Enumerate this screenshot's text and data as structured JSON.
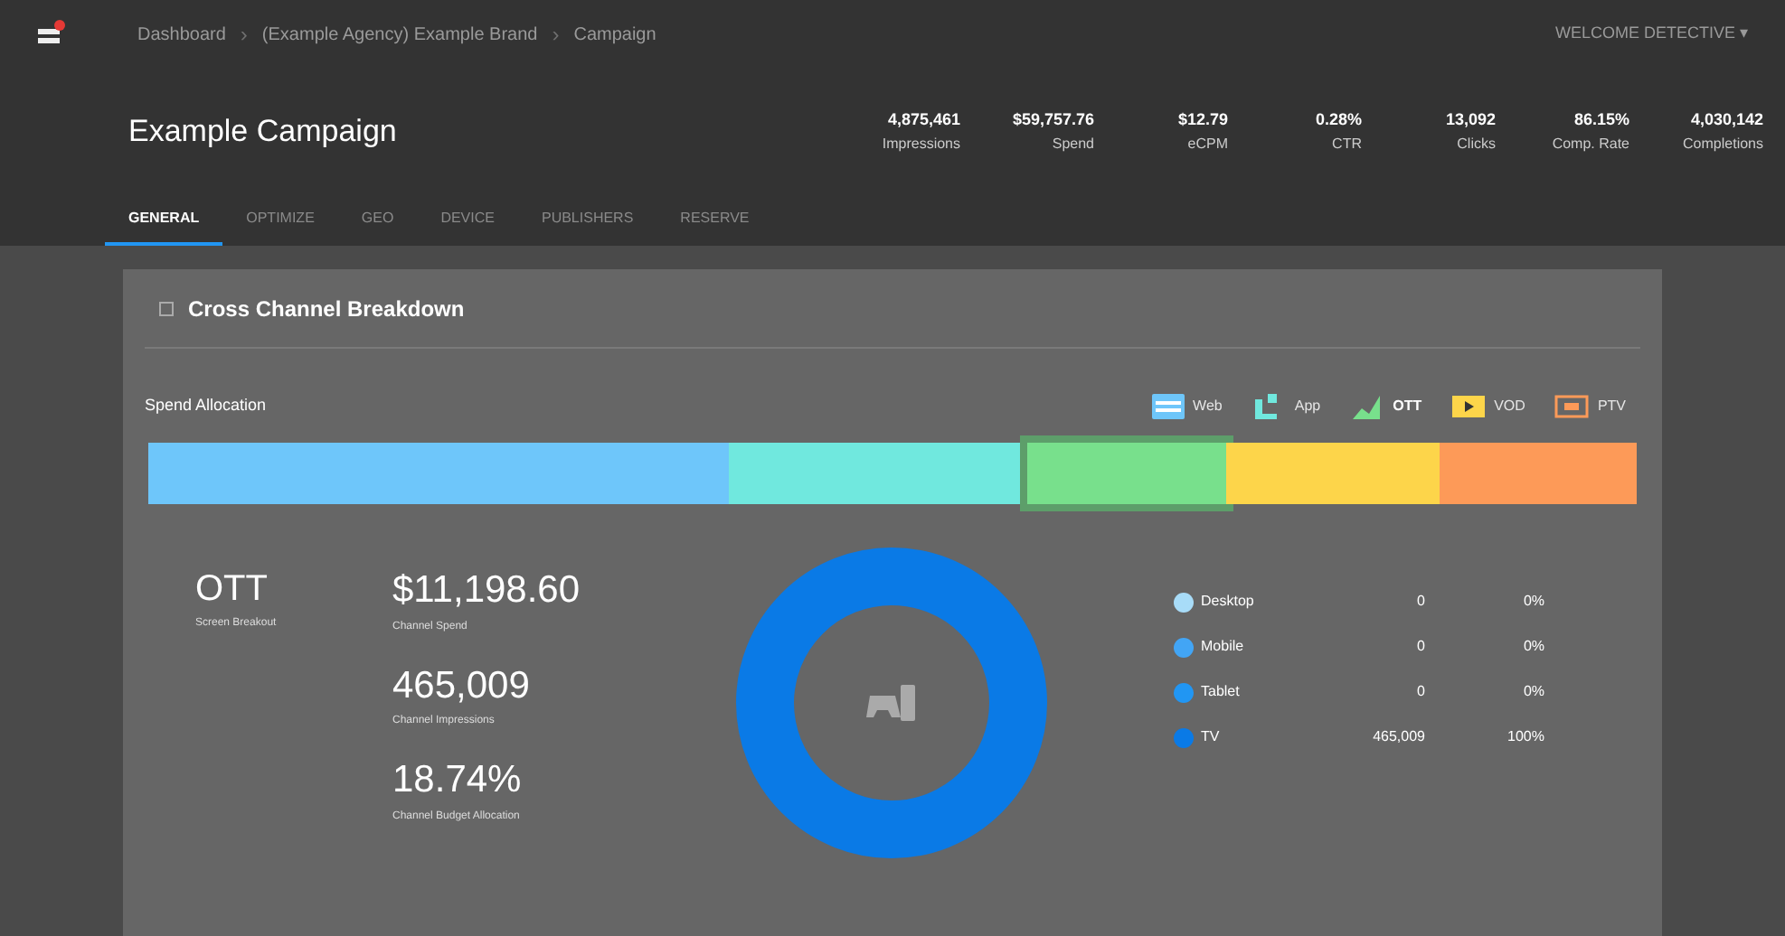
{
  "breadcrumb": [
    {
      "kind": "link",
      "text": "Dashboard"
    },
    {
      "kind": "separator",
      "text": "›"
    },
    {
      "kind": "link",
      "text": "(Example Agency) Example Brand"
    },
    {
      "kind": "separator",
      "text": "›"
    },
    {
      "kind": "link",
      "text": "Campaign"
    }
  ],
  "user_menu": "WELCOME DETECTIVE ▾",
  "title": "Example Campaign",
  "metrics": [
    {
      "value": "4,875,461",
      "label": "Impressions"
    },
    {
      "value": "$59,757.76",
      "label": "Spend"
    },
    {
      "value": "$12.79",
      "label": "eCPM"
    },
    {
      "value": "0.28%",
      "label": "CTR"
    },
    {
      "value": "13,092",
      "label": "Clicks"
    },
    {
      "value": "86.15%",
      "label": "Comp. Rate"
    },
    {
      "value": "4,030,142",
      "label": "Completions"
    }
  ],
  "tabs": [
    {
      "label": "GENERAL",
      "selected": true
    },
    {
      "label": "OPTIMIZE",
      "selected": false
    },
    {
      "label": "GEO",
      "selected": false
    },
    {
      "label": "DEVICE",
      "selected": false
    },
    {
      "label": "PUBLISHERS",
      "selected": false
    },
    {
      "label": "RESERVE",
      "selected": false
    }
  ],
  "card": {
    "title": "Cross Channel Breakdown",
    "allocation_label": "Spend Allocation",
    "channels": [
      {
        "label": "Web",
        "kind": "web",
        "color": "#6ec6fa",
        "selected": false
      },
      {
        "label": "App",
        "kind": "app",
        "color": "#70e8de",
        "selected": false
      },
      {
        "label": "OTT",
        "kind": "ott",
        "color": "#78e08c",
        "selected": true
      },
      {
        "label": "VOD",
        "kind": "vod",
        "color": "#fdd54a",
        "selected": false
      },
      {
        "label": "PTV",
        "kind": "ptv",
        "color": "#fd9a58",
        "selected": false
      }
    ],
    "channel": {
      "value": "OTT",
      "label": "Screen Breakout"
    },
    "stats": [
      {
        "value": "$11,198.60",
        "label": "Channel Spend"
      },
      {
        "value": "465,009",
        "label": "Channel Impressions"
      },
      {
        "value": "18.74%",
        "label": "Channel Budget Allocation"
      }
    ],
    "devices": [
      {
        "name": "Desktop",
        "color": "#a8dcf8",
        "count": "0",
        "percent": "0%"
      },
      {
        "name": "Mobile",
        "color": "#42a5f5",
        "count": "0",
        "percent": "0%"
      },
      {
        "name": "Tablet",
        "color": "#2196f3",
        "count": "0",
        "percent": "0%"
      },
      {
        "name": "TV",
        "color": "#0a7ae6",
        "count": "465,009",
        "percent": "100%"
      }
    ]
  }
}
